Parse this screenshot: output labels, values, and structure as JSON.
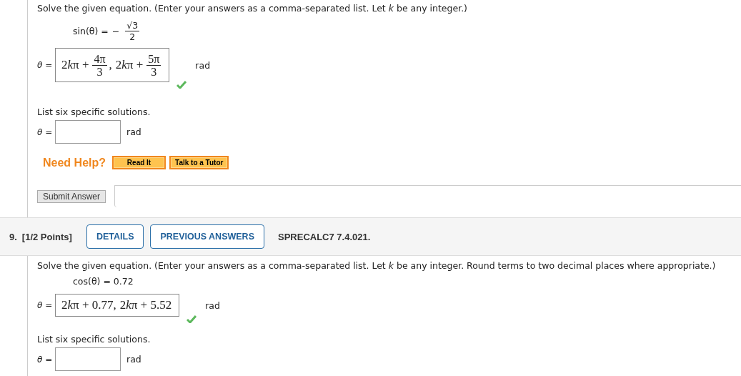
{
  "question_8": {
    "instruction": "Solve the given equation. (Enter your answers as a comma-separated list. Let *k* be any integer.)",
    "equation": {
      "lhs": "sin(θ) =",
      "sign": "−",
      "numerator": "√3",
      "denominator": "2"
    },
    "answer": {
      "label": "θ =",
      "terms": [
        {
          "coef": "2",
          "var": "k",
          "rest": "π +",
          "numerator": "4π",
          "denominator": "3"
        },
        {
          "coef": "2",
          "var": "k",
          "rest": "π +",
          "numerator": "5π",
          "denominator": "3"
        }
      ],
      "separator": ",",
      "unit": "rad",
      "correct": true
    },
    "specific": {
      "prompt": "List six specific solutions.",
      "label": "θ =",
      "unit": "rad"
    },
    "help": {
      "label": "Need Help?",
      "buttons": [
        "Read It",
        "Talk to a Tutor"
      ]
    },
    "submit": "Submit Answer"
  },
  "question_9": {
    "number": "9.",
    "points": "[1/2 Points]",
    "buttons": [
      "DETAILS",
      "PREVIOUS ANSWERS"
    ],
    "code": "SPRECALC7 7.4.021.",
    "instruction": "Solve the given equation. (Enter your answers as a comma-separated list. Let *k* be any integer. Round terms to two decimal places where appropriate.)",
    "equation": "cos(θ) = 0.72",
    "answer": {
      "label": "θ =",
      "terms": [
        {
          "coef": "2",
          "var": "k",
          "rest": "π + 0.77"
        },
        {
          "coef": "2",
          "var": "k",
          "rest": "π + 5.52"
        }
      ],
      "separator": ",",
      "unit": "rad",
      "correct": true
    },
    "specific": {
      "prompt": "List six specific solutions.",
      "label": "θ =",
      "unit": "rad"
    }
  }
}
